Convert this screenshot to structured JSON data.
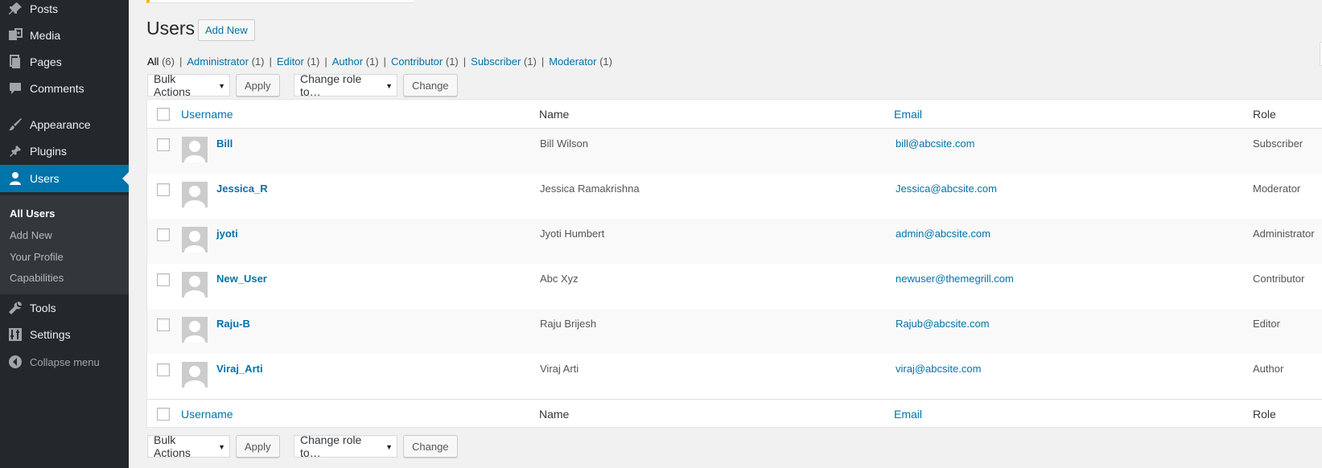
{
  "sidebar": {
    "items": [
      {
        "label": "Posts",
        "icon": "pin-icon"
      },
      {
        "label": "Media",
        "icon": "media-icon"
      },
      {
        "label": "Pages",
        "icon": "pages-icon"
      },
      {
        "label": "Comments",
        "icon": "comments-icon"
      },
      {
        "label": "Appearance",
        "icon": "brush-icon"
      },
      {
        "label": "Plugins",
        "icon": "plug-icon"
      },
      {
        "label": "Users",
        "icon": "user-icon"
      },
      {
        "label": "Tools",
        "icon": "wrench-icon"
      },
      {
        "label": "Settings",
        "icon": "sliders-icon"
      }
    ],
    "submenu": [
      "All Users",
      "Add New",
      "Your Profile",
      "Capabilities"
    ],
    "collapse_label": "Collapse menu"
  },
  "header": {
    "title": "Users",
    "add_new_label": "Add New"
  },
  "filters": [
    {
      "label": "All",
      "count": "(6)"
    },
    {
      "label": "Administrator",
      "count": "(1)"
    },
    {
      "label": "Editor",
      "count": "(1)"
    },
    {
      "label": "Author",
      "count": "(1)"
    },
    {
      "label": "Contributor",
      "count": "(1)"
    },
    {
      "label": "Subscriber",
      "count": "(1)"
    },
    {
      "label": "Moderator",
      "count": "(1)"
    }
  ],
  "toolbar": {
    "bulk_actions": "Bulk Actions",
    "apply": "Apply",
    "change_role": "Change role to…",
    "change": "Change"
  },
  "table": {
    "columns": [
      "Username",
      "Name",
      "Email",
      "Role"
    ],
    "rows": [
      {
        "username": "Bill",
        "name": "Bill Wilson",
        "email": "bill@abcsite.com",
        "role": "Subscriber"
      },
      {
        "username": "Jessica_R",
        "name": "Jessica Ramakrishna",
        "email": "Jessica@abcsite.com",
        "role": "Moderator"
      },
      {
        "username": "jyoti",
        "name": "Jyoti Humbert",
        "email": "admin@abcsite.com",
        "role": "Administrator"
      },
      {
        "username": "New_User",
        "name": "Abc Xyz",
        "email": "newuser@themegrill.com",
        "role": "Contributor"
      },
      {
        "username": "Raju-B",
        "name": "Raju Brijesh",
        "email": "Rajub@abcsite.com",
        "role": "Editor"
      },
      {
        "username": "Viraj_Arti",
        "name": "Viraj Arti",
        "email": "viraj@abcsite.com",
        "role": "Author"
      }
    ]
  },
  "colors": {
    "accent": "#0073aa",
    "sidebar": "#23282d",
    "submenu": "#32373c"
  }
}
